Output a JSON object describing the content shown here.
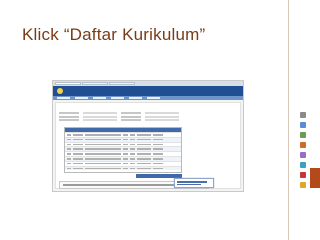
{
  "slide": {
    "title": "Klick “Daftar Kurikulum”"
  },
  "colors": {
    "title": "#7a3b16",
    "banner": "#1f4e92",
    "table_header": "#3f69a8",
    "accent": "#b24a1c"
  },
  "tools": [
    {
      "icon": "search-icon",
      "color": "#8a8a8a"
    },
    {
      "icon": "document-icon",
      "color": "#5a8bd6"
    },
    {
      "icon": "gear-icon",
      "color": "#6b9c4f"
    },
    {
      "icon": "bookmark-icon",
      "color": "#d06a2a"
    },
    {
      "icon": "print-icon",
      "color": "#9a6cc9"
    },
    {
      "icon": "share-icon",
      "color": "#3c9fc2"
    },
    {
      "icon": "alert-icon",
      "color": "#c73737"
    },
    {
      "icon": "folder-icon",
      "color": "#e0a52c"
    }
  ]
}
